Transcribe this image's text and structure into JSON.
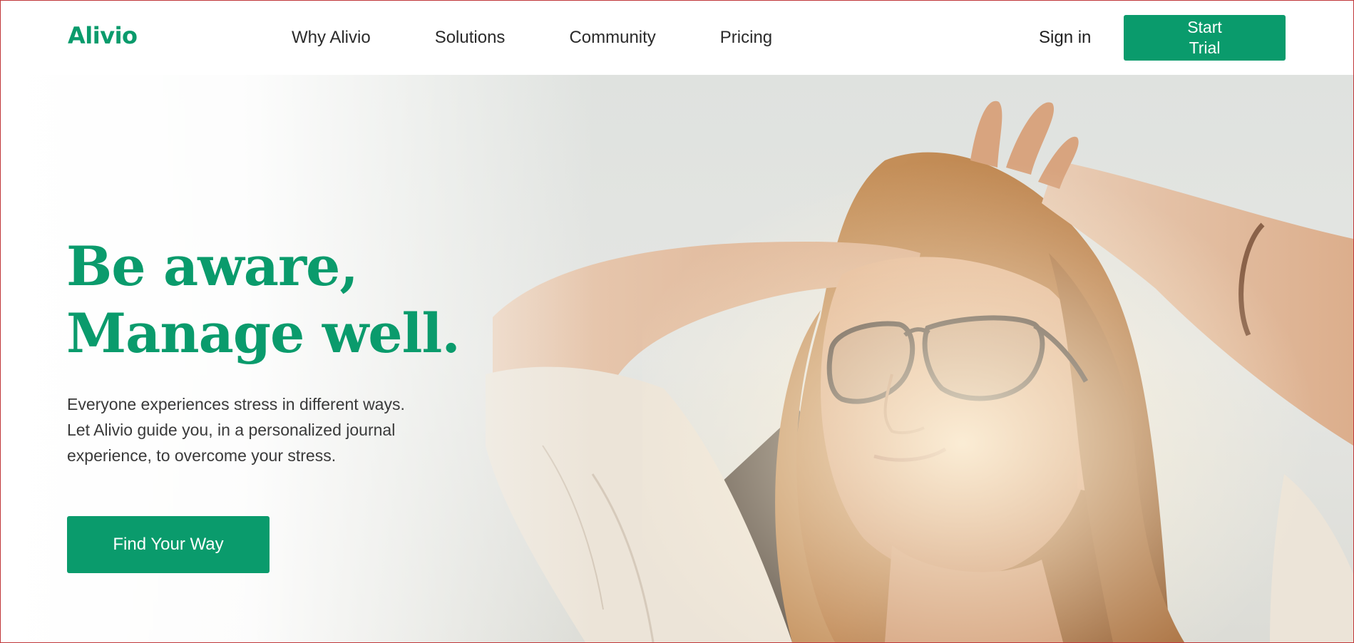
{
  "colors": {
    "brand": "#0a9b6c",
    "border": "#c0373a"
  },
  "header": {
    "logo": "Alivio",
    "nav": [
      {
        "label": "Why Alivio"
      },
      {
        "label": "Solutions"
      },
      {
        "label": "Community"
      },
      {
        "label": "Pricing"
      }
    ],
    "sign_in": "Sign in",
    "start_trial": "Start Trial"
  },
  "hero": {
    "title_line_1": "Be aware,",
    "title_line_2": "Manage well.",
    "text_lines": [
      "Everyone experiences stress in different ways.",
      "Let Alivio guide you, in a personalized journal",
      "experience, to overcome your stress."
    ],
    "cta_label": "Find Your Way",
    "image_subject": "woman-with-glasses-relaxing-in-sunlight"
  }
}
